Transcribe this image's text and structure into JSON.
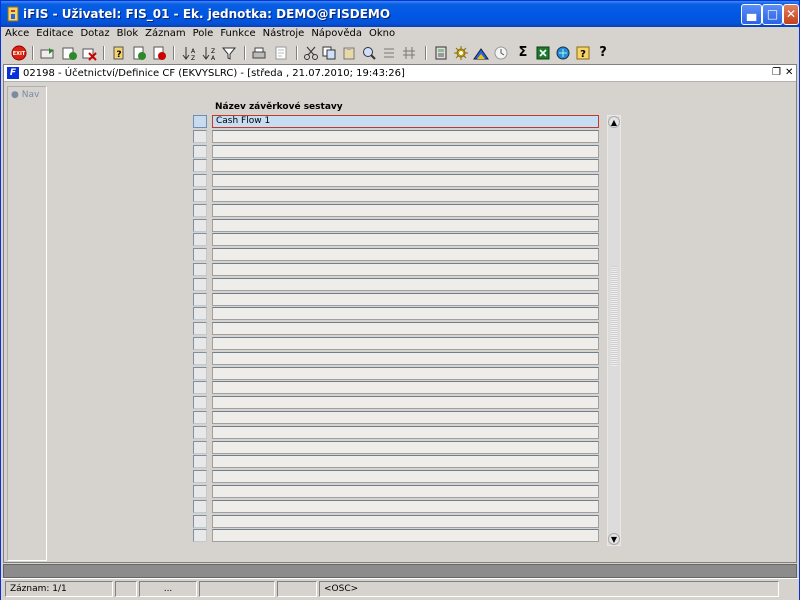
{
  "window": {
    "title": "iFIS - Uživatel: FIS_01 - Ek. jednotka: DEMO@FISDEMO",
    "min_icon": "minimize-icon",
    "max_icon": "maximize-icon",
    "close_icon": "close-icon"
  },
  "menu": [
    {
      "label": "Akce"
    },
    {
      "label": "Editace"
    },
    {
      "label": "Dotaz"
    },
    {
      "label": "Blok"
    },
    {
      "label": "Záznam"
    },
    {
      "label": "Pole"
    },
    {
      "label": "Funkce"
    },
    {
      "label": "Nástroje"
    },
    {
      "label": "Nápověda"
    },
    {
      "label": "Okno"
    }
  ],
  "toolbar_icons": [
    "exit-icon",
    "save-icon",
    "new-record-icon",
    "delete-record-icon",
    "enter-query-icon",
    "execute-query-icon",
    "cancel-query-icon",
    "sort-asc-icon",
    "sort-desc-icon",
    "filter-icon",
    "print-icon",
    "print-preview-icon",
    "cut-icon",
    "copy-icon",
    "paste-icon",
    "zoom-icon",
    "list-icon",
    "columns-icon",
    "calculator-icon",
    "settings-icon",
    "chart-icon",
    "clock-icon",
    "sum-icon",
    "excel-icon",
    "export-icon",
    "help-icon",
    "context-help-icon"
  ],
  "document": {
    "title": "02198 - Účetnictví/Definice CF (EKVYSLRC) - [středa , 21.07.2010; 19:43:26]",
    "nav_label": "Nav"
  },
  "grid": {
    "column_header": "Název závěrkové sestavy",
    "rows": [
      "Cash Flow 1",
      "",
      "",
      "",
      "",
      "",
      "",
      "",
      "",
      "",
      "",
      "",
      "",
      "",
      "",
      "",
      "",
      "",
      "",
      "",
      "",
      "",
      "",
      "",
      "",
      "",
      "",
      "",
      ""
    ]
  },
  "status": {
    "record": "Záznam: 1/1",
    "field2": "",
    "field3": "...",
    "field4": "",
    "mode": "<OSC>"
  },
  "colors": {
    "title_bar": "#0058e6",
    "selected_row": "#c6ddf2",
    "selected_border": "#c0392b"
  }
}
